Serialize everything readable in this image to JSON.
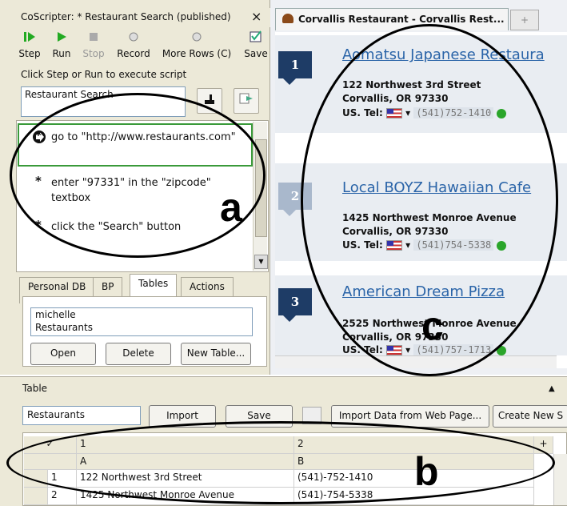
{
  "left_panel": {
    "title": "CoScripter: * Restaurant Search (published)",
    "close": "×",
    "toolbar": [
      {
        "label": "Step",
        "icon": "step-icon",
        "enabled": true
      },
      {
        "label": "Run",
        "icon": "play-icon",
        "enabled": true
      },
      {
        "label": "Stop",
        "icon": "stop-icon",
        "enabled": false
      },
      {
        "label": "Record",
        "icon": "record-icon",
        "enabled": true
      },
      {
        "label": "More Rows (C)",
        "icon": "more-rows-icon",
        "enabled": true
      },
      {
        "label": "Save",
        "icon": "save-icon",
        "enabled": true
      }
    ],
    "hint": "Click Step or Run to execute script",
    "script_name": "Restaurant Search",
    "steps": [
      "go to \"http://www.restaurants.com\"",
      "enter \"97331\" in the \"zipcode\" textbox",
      "click the \"Search\" button"
    ],
    "tabs": [
      "Personal DB",
      "BP",
      "Tables",
      "Actions"
    ],
    "active_tab": "Tables",
    "tables_list": [
      "michelle",
      "Restaurants"
    ],
    "buttons": {
      "open": "Open",
      "delete": "Delete",
      "new_table": "New Table..."
    }
  },
  "browser": {
    "tab_title": "Corvallis Restaurant - Corvallis Rest...",
    "new_tab": "+",
    "tel_label": "US. Tel:",
    "results": [
      {
        "rank": "1",
        "name": "Aomatsu Japanese Restaura",
        "addr1": "122 Northwest 3rd Street",
        "addr2": "Corvallis, OR 97330",
        "phone": "(541)752-1410"
      },
      {
        "rank": "2",
        "name": "Local BOYZ Hawaiian Cafe",
        "addr1": "1425 Northwest Monroe Avenue",
        "addr2": "Corvallis, OR 97330",
        "phone": "(541)754-5338"
      },
      {
        "rank": "3",
        "name": "American Dream Pizza",
        "addr1": "2525 Northwest Monroe Avenue",
        "addr2": "Corvallis, OR 97330",
        "phone": "(541)757-1713"
      }
    ]
  },
  "table_panel": {
    "header": "Table",
    "table_name": "Restaurants",
    "buttons": {
      "import": "Import",
      "save": "Save",
      "import_web": "Import Data from Web Page...",
      "create_new": "Create New S"
    },
    "column_numbers": [
      "1",
      "2"
    ],
    "column_letters": [
      "A",
      "B"
    ],
    "rows": [
      {
        "num": "1",
        "a": "122 Northwest 3rd Street",
        "b": "(541)-752-1410"
      },
      {
        "num": "2",
        "a": "1425 Northwest Monroe Avenue",
        "b": "(541)-754-5338"
      }
    ],
    "add": "+"
  },
  "annotations": {
    "a": "a",
    "b": "b",
    "c": "c"
  }
}
